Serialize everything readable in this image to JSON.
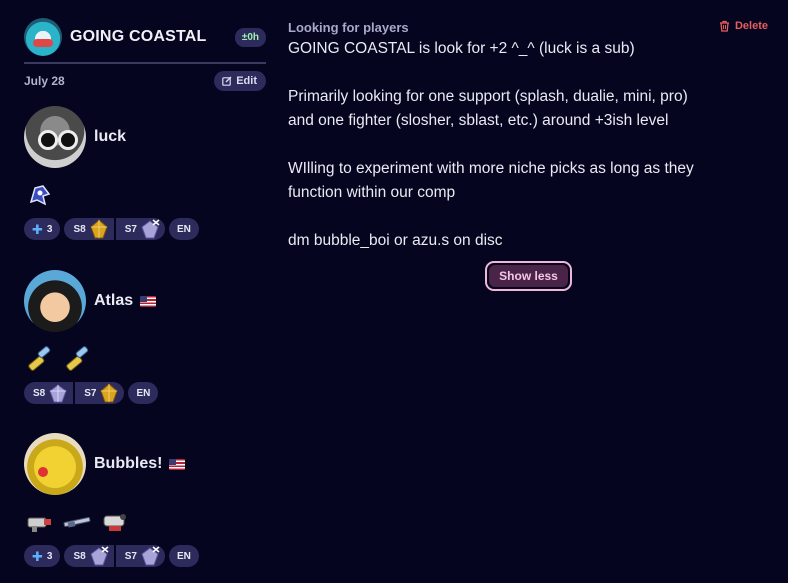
{
  "team": {
    "name": "GOING COASTAL",
    "time_badge": "±0h",
    "date": "July 28",
    "edit_label": "Edit"
  },
  "players": [
    {
      "name": "luck",
      "flag": "",
      "weapons": [
        "squid-emblem-icon"
      ],
      "plus": "3",
      "tiers": [
        {
          "season": "S8",
          "rank": "gold-crystal"
        },
        {
          "season": "S7",
          "rank": "silver-crystal-x"
        }
      ],
      "language": "EN"
    },
    {
      "name": "Atlas",
      "flag": "us-flag-icon",
      "weapons": [
        "roller-weapon-icon",
        "roller-weapon-icon"
      ],
      "plus": "",
      "tiers": [
        {
          "season": "S8",
          "rank": "silver-crystal"
        },
        {
          "season": "S7",
          "rank": "gold-crystal"
        }
      ],
      "language": "EN"
    },
    {
      "name": "Bubbles!",
      "flag": "us-flag-icon",
      "weapons": [
        "blaster-weapon-icon",
        "charger-weapon-icon",
        "splatling-weapon-icon"
      ],
      "plus": "3",
      "tiers": [
        {
          "season": "S8",
          "rank": "silver-crystal-x"
        },
        {
          "season": "S7",
          "rank": "silver-crystal-x"
        }
      ],
      "language": "EN"
    }
  ],
  "post": {
    "heading": "Looking for players",
    "delete_label": "Delete",
    "paragraphs": [
      "GOING COASTAL is look for +2 ^_^ (luck is a sub)",
      "",
      "Primarily looking for one support (splash, dualie, mini, pro)",
      "and one fighter (slosher, sblast, etc.) around +3ish level",
      "",
      "WIlling to experiment with more niche picks as long as they",
      "function within our comp",
      "",
      "dm bubble_boi or azu.s on disc"
    ],
    "show_less_label": "Show less"
  },
  "colors": {
    "background": "#05051f",
    "pill": "#2c2b5c",
    "delete": "#e85d5d",
    "accent_pink": "#f0b8d8"
  }
}
